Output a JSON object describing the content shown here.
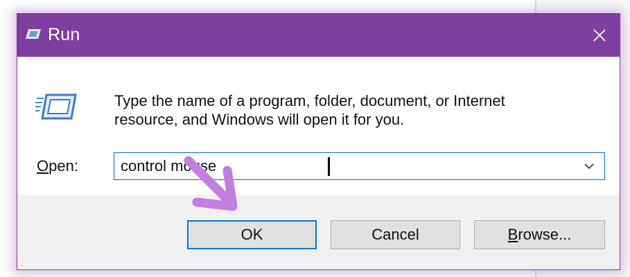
{
  "window": {
    "title": "Run",
    "title_icon": "run-app-icon",
    "close_glyph": "✕"
  },
  "body": {
    "icon": "run-program-icon",
    "description_line1": "Type the name of a program, folder, document, or Internet",
    "description_line2": "resource, and Windows will open it for you.",
    "open_label_accel": "O",
    "open_label_rest": "pen:",
    "open_value": "control mouse"
  },
  "buttons": {
    "ok_label": "OK",
    "cancel_label": "Cancel",
    "browse_accel": "B",
    "browse_rest": "rowse..."
  },
  "annotation": {
    "icon": "pointer-arrow-icon",
    "color": "#c27ee0"
  },
  "colors": {
    "titlebar": "#7f3fa0",
    "focus_border": "#0078d7",
    "footer": "#f0f0f0"
  }
}
